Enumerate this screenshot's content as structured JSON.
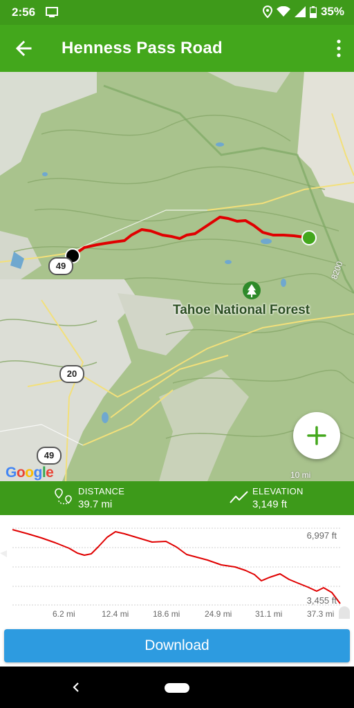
{
  "status_bar": {
    "time": "2:56",
    "battery": "35%"
  },
  "app_bar": {
    "title": "Henness Pass Road"
  },
  "map": {
    "region_label": "Tahoe National Forest",
    "route_shields": [
      "49",
      "20",
      "49"
    ],
    "contour_label": "8200",
    "scale": "10 mi",
    "attribution": [
      "G",
      "o",
      "o",
      "g",
      "l",
      "e"
    ]
  },
  "stats": {
    "distance_label": "DISTANCE",
    "distance_value": "39.7 mi",
    "elevation_label": "ELEVATION",
    "elevation_value": "3,149 ft"
  },
  "elevation_profile": {
    "max_label": "6,997 ft",
    "min_label": "3,455 ft",
    "x_ticks": [
      "6.2 mi",
      "12.4 mi",
      "18.6 mi",
      "24.9 mi",
      "31.1 mi",
      "37.3 mi"
    ]
  },
  "download_label": "Download",
  "colors": {
    "accent": "#43a71c",
    "route": "#e00000",
    "button": "#2d9be0"
  }
}
